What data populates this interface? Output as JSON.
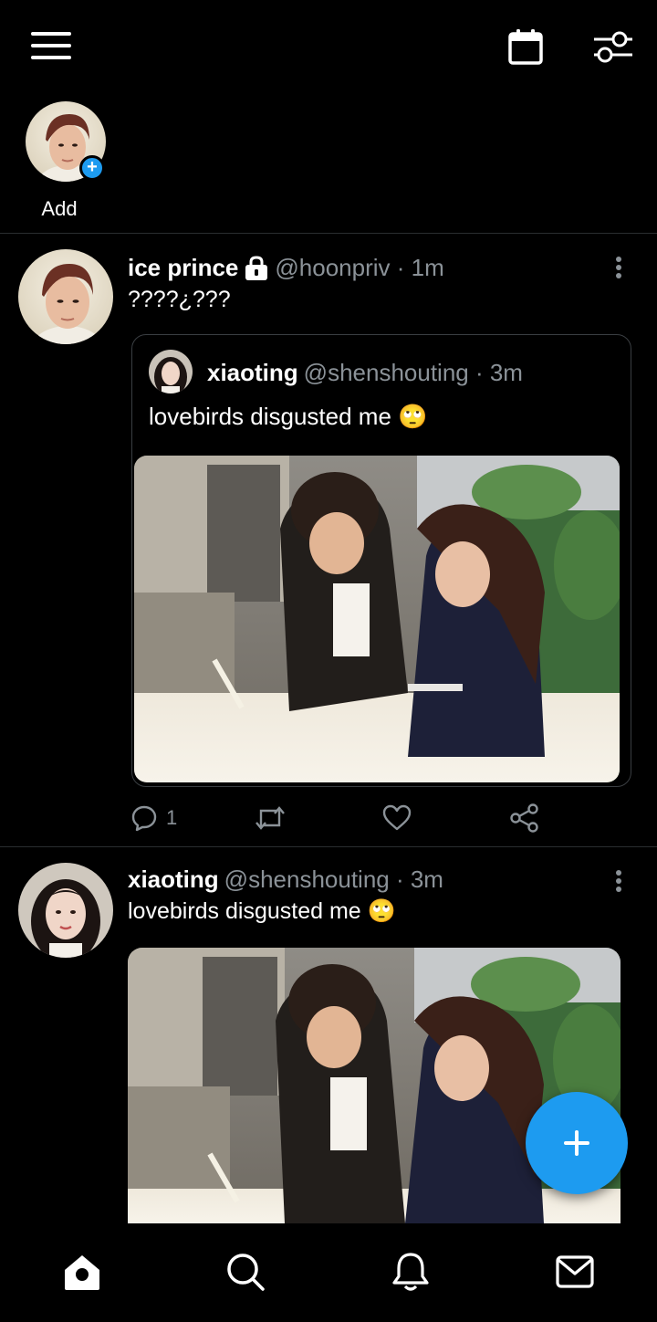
{
  "topbar": {
    "menu_icon": "hamburger-menu-icon",
    "calendar_icon": "calendar-icon",
    "filter_icon": "sliders-icon"
  },
  "stories": {
    "add_label": "Add"
  },
  "posts": [
    {
      "name": "ice prince",
      "handle": "@hoonpriv · 1m",
      "text": "????¿???",
      "locked": true,
      "quote": {
        "name": "xiaoting",
        "handle": "@shenshouting · 3m",
        "text": "lovebirds disgusted me 🙄"
      },
      "actions": {
        "reply_count": "1",
        "retweet_count": "",
        "like_count": ""
      }
    },
    {
      "name": "xiaoting",
      "handle": "@shenshouting · 3m",
      "text": "lovebirds disgusted me 🙄"
    }
  ],
  "colors": {
    "accent": "#1d9bf0",
    "background": "#000000",
    "secondary_text": "#8b9298",
    "divider": "#2a2d30"
  },
  "bottom_nav": [
    "home-icon",
    "search-icon",
    "bell-icon",
    "mail-icon"
  ]
}
